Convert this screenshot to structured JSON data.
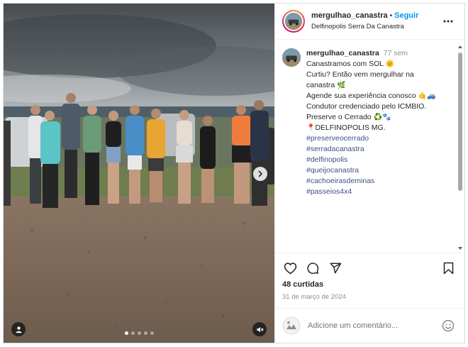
{
  "post": {
    "username": "mergulhao_canastra",
    "separator": "•",
    "follow_label": "Seguir",
    "location": "Delfinopolis Serra Da Canastra"
  },
  "caption": {
    "username": "mergulhao_canastra",
    "time": "77 sem",
    "line1": "Canastramos com SOL ",
    "line1_emoji": "🌞",
    "line2": "Curtiu? Então vem mergulhar na",
    "line3": "canastra ",
    "line3_emoji": "🌿",
    "line4": "Agende sua experiência conosco ",
    "line4_emoji": "🤙🚙",
    "line5": "Condutor credenciado pelo ICMBIO.",
    "line6": "Preserve o Cerrado ",
    "line6_emoji": "♻️🐾",
    "line7_emoji": "📍",
    "line7": "DELFINOPOLIS MG.",
    "hashtags": [
      "#preserveocerrado",
      "#serradacanastra",
      "#delfinopolis",
      "#queijocanastra",
      "#cachoeirasdeminas",
      "#passeios4x4"
    ]
  },
  "engagement": {
    "likes": "48 curtidas",
    "date": "31 de março de 2024"
  },
  "comment": {
    "placeholder": "Adicione um comentário..."
  },
  "carousel": {
    "slide_count": 5,
    "active_index": 0
  },
  "icons": {
    "next": "chevron-right-icon",
    "tag": "person-icon",
    "mute": "speaker-muted-icon",
    "more": "more-horizontal-icon",
    "like": "heart-icon",
    "comment": "speech-bubble-icon",
    "share": "paper-plane-icon",
    "save": "bookmark-icon",
    "emoji": "smiley-icon"
  },
  "colors": {
    "follow": "#0095f6",
    "hashtag": "#385185",
    "muted_text": "#8e8e8e",
    "border": "#dbdbdb"
  }
}
